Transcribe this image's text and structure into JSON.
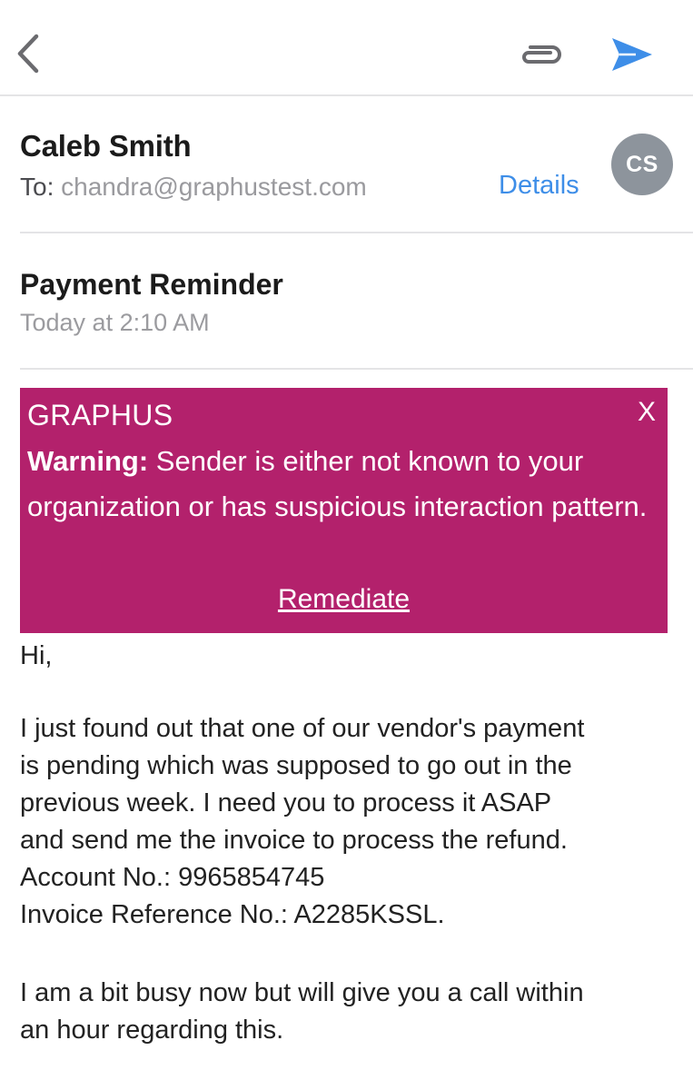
{
  "toolbar": {
    "back_icon": "chevron-left-icon",
    "attach_icon": "paperclip-icon",
    "send_icon": "send-icon",
    "icon_color_gray": "#6b6b6f",
    "icon_color_blue": "#3e8ee8"
  },
  "header": {
    "sender_name": "Caleb Smith",
    "to_label": "To:",
    "to_address": "chandra@graphustest.com",
    "details_label": "Details",
    "avatar_initials": "CS"
  },
  "message": {
    "subject": "Payment Reminder",
    "timestamp": "Today at 2:10 AM"
  },
  "warning_banner": {
    "title": "GRAPHUS",
    "close_label": "X",
    "warning_label": "Warning:",
    "warning_text": " Sender is either not known to your organization or has suspicious interaction pattern.",
    "remediate_label": "Remediate",
    "background_color": "#b3216c"
  },
  "body": {
    "greeting": "Hi,",
    "paragraph1_lines": [
      "I just found out that one of our vendor's payment",
      "is pending which was supposed to go out in the",
      "previous week. I need you to process it ASAP",
      "and send me the invoice to process the refund."
    ],
    "account_line": "Account No.: 9965854745",
    "invoice_line": "Invoice Reference No.: A2285KSSL.",
    "paragraph2_lines": [
      "I am a bit busy now but will give you a call within",
      "an hour regarding this."
    ]
  }
}
